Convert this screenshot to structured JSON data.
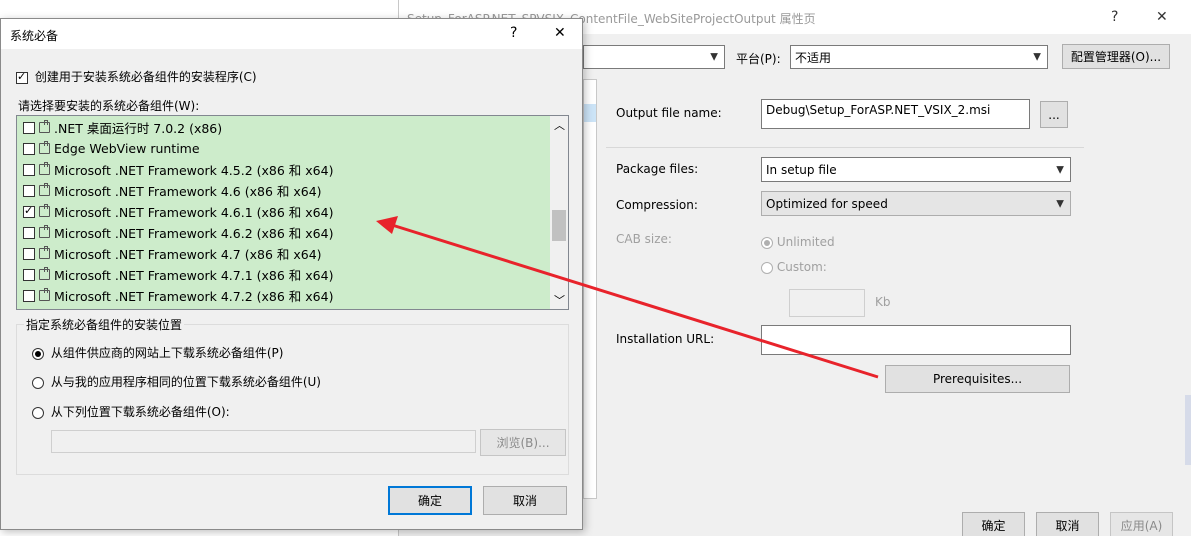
{
  "prop_window": {
    "title": "Setup_ForASP.NET_SPVSIX_ContentFile_WebSiteProjectOutput 属性页",
    "help": "?",
    "close": "✕",
    "platform_label": "平台(P):",
    "platform_value": "不适用",
    "config_manager": "配置管理器(O)...",
    "output_label": "Output file name:",
    "output_value": "Debug\\Setup_ForASP.NET_VSIX_2.msi",
    "browse_dots": "...",
    "package_label": "Package files:",
    "package_value": "In setup file",
    "compression_label": "Compression:",
    "compression_value": "Optimized for speed",
    "cab_label": "CAB size:",
    "unlimited": "Unlimited",
    "custom": "Custom:",
    "kb": "Kb",
    "install_url_label": "Installation URL:",
    "install_url_value": "",
    "prerequisites": "Prerequisites...",
    "ok": "确定",
    "cancel": "取消",
    "apply": "应用(A)"
  },
  "prereq_dialog": {
    "title": "系统必备",
    "help": "?",
    "close": "✕",
    "create_installer": "创建用于安装系统必备组件的安装程序(C)",
    "choose_label": "请选择要安装的系统必备组件(W):",
    "items": [
      {
        "label": ".NET 桌面运行时 7.0.2 (x86)",
        "checked": false
      },
      {
        "label": "Edge WebView runtime",
        "checked": false
      },
      {
        "label": "Microsoft .NET Framework 4.5.2 (x86 和 x64)",
        "checked": false
      },
      {
        "label": "Microsoft .NET Framework 4.6 (x86 和 x64)",
        "checked": false
      },
      {
        "label": "Microsoft .NET Framework 4.6.1 (x86 和 x64)",
        "checked": true
      },
      {
        "label": "Microsoft .NET Framework 4.6.2 (x86 和 x64)",
        "checked": false
      },
      {
        "label": "Microsoft .NET Framework 4.7 (x86 和 x64)",
        "checked": false
      },
      {
        "label": "Microsoft .NET Framework 4.7.1 (x86 和 x64)",
        "checked": false
      },
      {
        "label": "Microsoft .NET Framework 4.7.2 (x86 和 x64)",
        "checked": false
      }
    ],
    "location_group": "指定系统必备组件的安装位置",
    "opt_vendor": "从组件供应商的网站上下载系统必备组件(P)",
    "opt_same": "从与我的应用程序相同的位置下载系统必备组件(U)",
    "opt_custom": "从下列位置下载系统必备组件(O):",
    "location_value": "",
    "browse": "浏览(B)...",
    "ok": "确定",
    "cancel": "取消"
  },
  "colors": {
    "list_bg": "#cdeccb",
    "arrow": "#e8232b",
    "accent": "#0078d7"
  }
}
